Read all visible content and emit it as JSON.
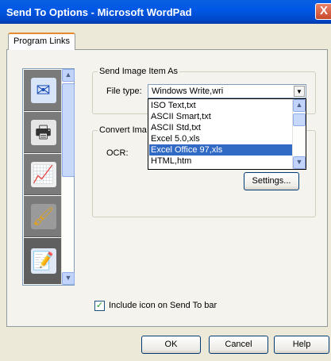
{
  "window": {
    "title": "Send To Options - Microsoft WordPad",
    "close_glyph": "X"
  },
  "tabs": [
    {
      "label": "Program Links"
    }
  ],
  "icon_list": {
    "items": [
      {
        "icon": "send-email-icon",
        "glyph": "✉"
      },
      {
        "icon": "printer-send-icon",
        "glyph": "🖶"
      },
      {
        "icon": "chart-fax-icon",
        "glyph": "📈"
      },
      {
        "icon": "paint-brushes-icon",
        "glyph": "🖌"
      },
      {
        "icon": "notepad-pencil-icon",
        "glyph": "📝"
      }
    ]
  },
  "send_image": {
    "legend": "Send Image Item As",
    "file_type_label": "File type:",
    "file_type_value": "Windows Write,wri",
    "options": [
      "ISO Text,txt",
      "ASCII Smart,txt",
      "ASCII Std,txt",
      "Excel 5.0,xls",
      "Excel Office 97,xls",
      "HTML,htm"
    ],
    "selected_option": "Excel Office 97,xls"
  },
  "convert": {
    "legend": "Convert Ima",
    "ocr_label": "OCR:",
    "settings_label": "Settings..."
  },
  "include_icon": {
    "label": "Include icon on Send To bar",
    "checked": true,
    "check_glyph": "✓"
  },
  "buttons": {
    "ok": "OK",
    "cancel": "Cancel",
    "help": "Help"
  },
  "colors": {
    "title_bar": "#0058e6",
    "selection": "#316ac5",
    "tab_accent": "#e68b2c"
  }
}
